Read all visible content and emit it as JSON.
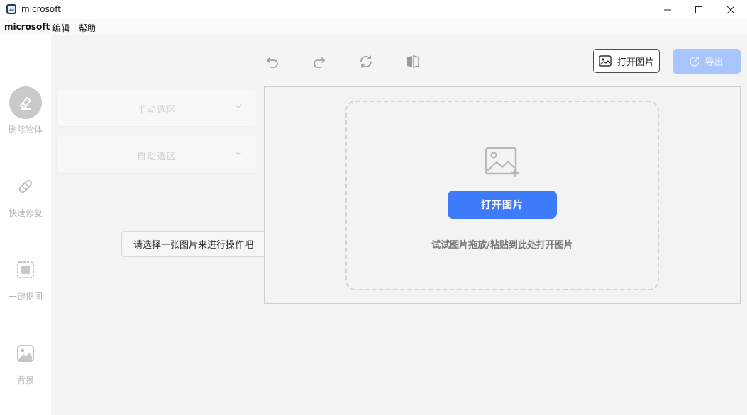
{
  "window": {
    "title": "microsoft",
    "controls": [
      "minimize-icon",
      "maximize-icon",
      "close-icon"
    ]
  },
  "menubar": {
    "items": [
      {
        "label": "microsoft"
      },
      {
        "label": "编辑"
      },
      {
        "label": "帮助"
      }
    ]
  },
  "sidebar": {
    "items": [
      {
        "label": "删除物体",
        "icon": "eraser-icon",
        "active": true
      },
      {
        "label": "快速修复",
        "icon": "bandage-icon",
        "active": false
      },
      {
        "label": "一键抠图",
        "icon": "cutout-icon",
        "active": false
      },
      {
        "label": "背景",
        "icon": "background-image-icon",
        "active": false
      }
    ]
  },
  "toolbar": {
    "icons": [
      "undo-icon",
      "redo-icon",
      "reset-icon",
      "compare-icon"
    ],
    "open_label": "打开图片",
    "export_label": "导出"
  },
  "panels": {
    "manual_label": "手动选区",
    "auto_label": "自动选区",
    "tooltip": "请选择一张图片来进行操作吧"
  },
  "canvas": {
    "open_button_label": "打开图片",
    "hint": "试试图片拖放/粘贴到此处打开图片"
  },
  "colors": {
    "accent": "#3d7bfa",
    "export_disabled": "#a8c5fd",
    "sidebar_active": "#c9c9c9"
  }
}
